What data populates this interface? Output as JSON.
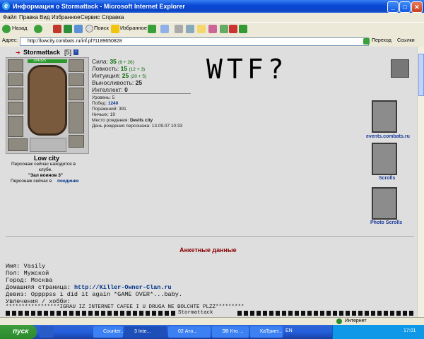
{
  "window": {
    "title": "Информация о Stormattack - Microsoft Internet Explorer"
  },
  "menu": [
    "Файл",
    "Правка",
    "Вид",
    "Избранное",
    "Сервис",
    "Справка"
  ],
  "toolbar": {
    "back": "Назад",
    "search": "Поиск",
    "favorites": "Избранное"
  },
  "address": {
    "label": "Адрес:",
    "url": "http://lowcity.combats.ru/inf.pl?1189650828",
    "go": "Переход",
    "links": "Ссылки"
  },
  "character": {
    "name": "Stormattack",
    "level": "[5]",
    "hp": "324/325",
    "city": "Low city",
    "location_line1": "Персонаж сейчас находится в",
    "location_line2": "клубе.",
    "hall": "\"Зал воинов 3\"",
    "fight_prefix": "Персонаж сейчас в",
    "fight_link": "поединке"
  },
  "stats": {
    "strength": {
      "label": "Сила:",
      "value": "35",
      "extra": "(9 + 26)"
    },
    "agility": {
      "label": "Ловкость:",
      "value": "15",
      "extra": "(12 + 3)"
    },
    "intuition": {
      "label": "Интуиция:",
      "value": "25",
      "extra": "(20 + 5)"
    },
    "endurance": {
      "label": "Выносливость:",
      "value": "25"
    },
    "intellect": {
      "label": "Интеллект:",
      "value": "0"
    }
  },
  "info": {
    "level": "Уровень: 5",
    "wins_label": "Побед:",
    "wins": "1240",
    "losses": "Поражений: 391",
    "draws": "Ничьих: 19",
    "birthplace_label": "Место рождения:",
    "birthplace": "Devils city",
    "birthday": "День рождения персонажа: 13.09.07 10:33"
  },
  "overlay": "WTF?",
  "banners": [
    "events.combats.ru",
    "Scrolls",
    "Photo Scrolls"
  ],
  "profile": {
    "heading": "Анкетные данные",
    "name": "Имя: Vasily",
    "gender": "Пол: Мужской",
    "city": "Город: Москва",
    "homepage_label": "Домашняя страница:",
    "homepage": "http://Killer-Owner-Clan.ru",
    "motto": "Девиз: Oppppss i did it again *GAME OVER*...baby.",
    "hobbies": "Увлечения / хобби:",
    "line1": "*****************IGRAU IZ INTERNET CAFEE I U DRUGA NE BOLCHTE PLZZ*********",
    "line2": "Stormattack"
  },
  "status": {
    "zone": "Интернет"
  },
  "taskbar": {
    "start": "пуск",
    "tasks": [
      "Counter...",
      "3 Inte...",
      "02 Ато...",
      "ЭВ Кто ...",
      "КаТриет..."
    ],
    "lang": "EN",
    "clock": "17:01"
  },
  "colors": {
    "titlebar": "#0a4ad8",
    "page_bg": "#dedede",
    "heading": "#8b0000",
    "link": "#003388"
  }
}
